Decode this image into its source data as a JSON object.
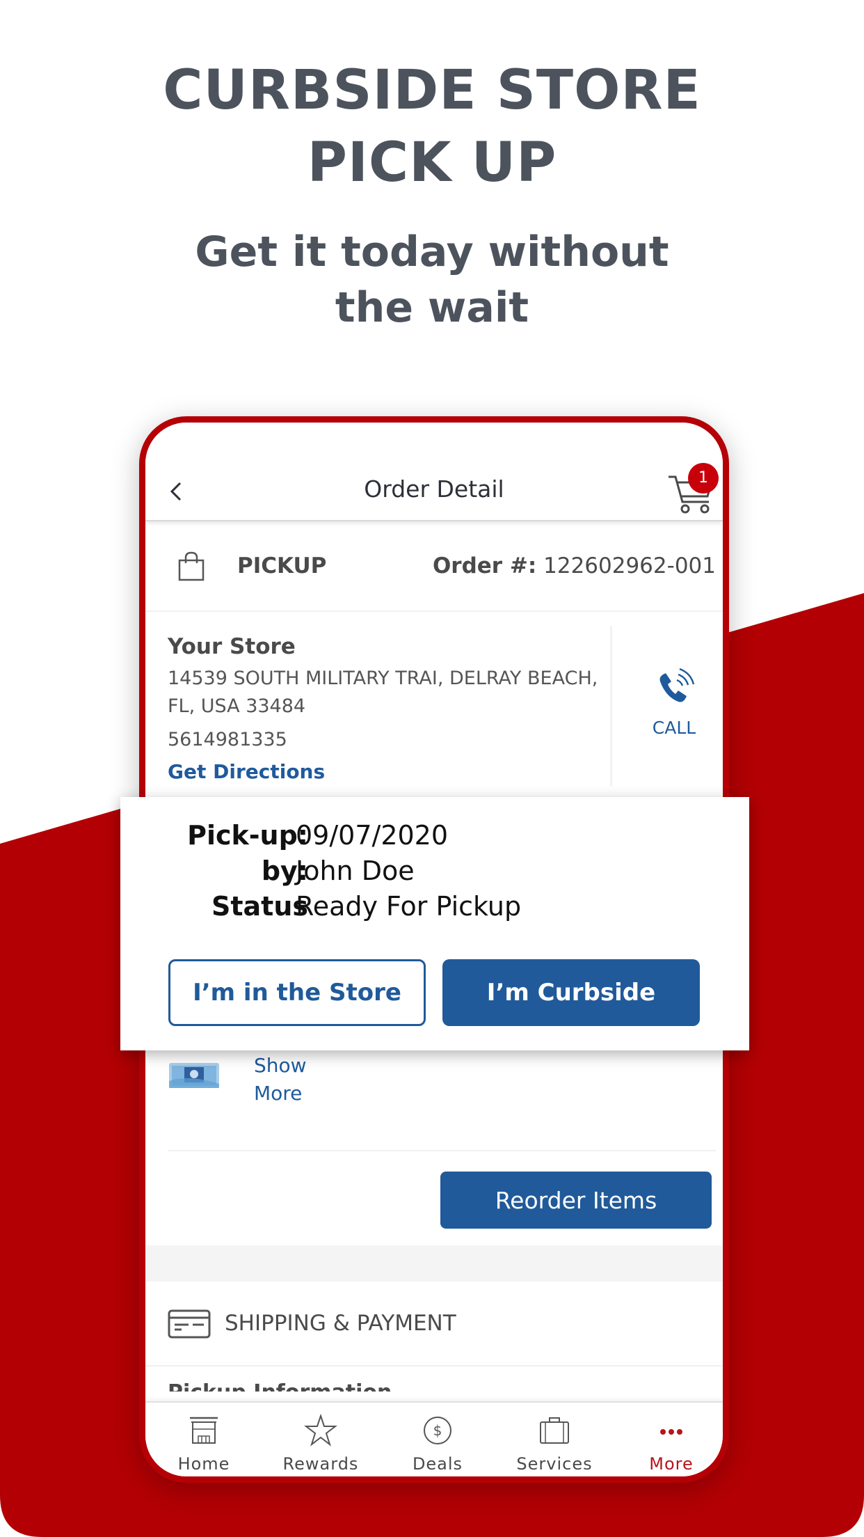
{
  "promo": {
    "title_line1": "CURBSIDE STORE",
    "title_line2": "PICK UP",
    "subtitle_line1": "Get it today without",
    "subtitle_line2": "the wait"
  },
  "colors": {
    "brand_red": "#b50005",
    "accent_blue": "#205a9a",
    "headline_gray": "#4c535c"
  },
  "header": {
    "title": "Order Detail",
    "back_icon": "chevron-left-icon",
    "cart_icon": "cart-icon",
    "cart_count": "1"
  },
  "order": {
    "type_icon": "shopping-bag-icon",
    "type_label": "PICKUP",
    "order_label": "Order #:",
    "order_number": "122602962-001"
  },
  "store": {
    "title": "Your Store",
    "address_line1": "14539 SOUTH MILITARY TRAI, DELRAY BEACH,",
    "address_line2": "FL, USA 33484",
    "phone": "5614981335",
    "directions_label": "Get Directions",
    "call_icon": "phone-ringing-icon",
    "call_label": "CALL"
  },
  "popup": {
    "rows": [
      {
        "label": "Pick-up:",
        "value": "09/07/2020"
      },
      {
        "label": "by:",
        "value": "John Doe"
      },
      {
        "label": "Status",
        "value": "Ready For Pickup"
      }
    ],
    "in_store_label": "I’m in the Store",
    "curbside_label": "I’m Curbside"
  },
  "items": {
    "show_more_line1": "Show",
    "show_more_line2": "More",
    "reorder_label": "Reorder Items"
  },
  "shipping": {
    "icon": "credit-card-icon",
    "label": "SHIPPING & PAYMENT",
    "next_section_peek": "Pickup Information"
  },
  "tabs": [
    {
      "label": "Home",
      "icon": "store-icon",
      "active": false
    },
    {
      "label": "Rewards",
      "icon": "star-icon",
      "active": false
    },
    {
      "label": "Deals",
      "icon": "dollar-coin-icon",
      "active": false
    },
    {
      "label": "Services",
      "icon": "briefcase-icon",
      "active": false
    },
    {
      "label": "More",
      "icon": "more-dots-icon",
      "active": true
    }
  ]
}
